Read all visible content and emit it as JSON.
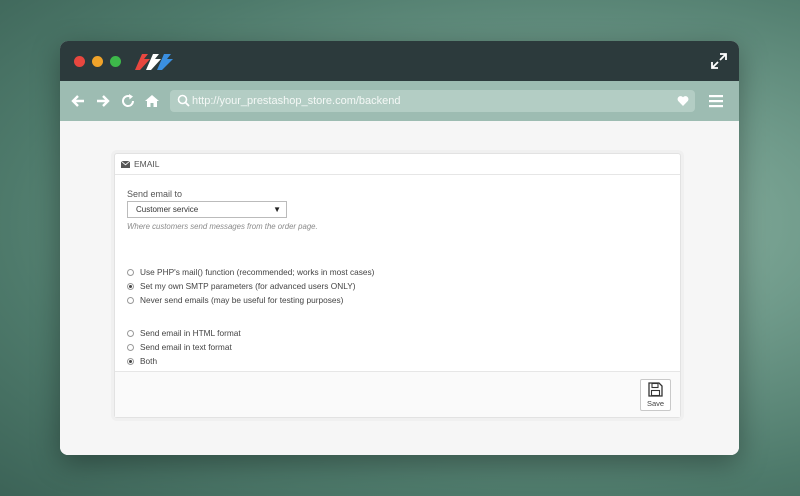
{
  "browser": {
    "url_placeholder": "http://your_prestashop_store.com/backend"
  },
  "panel": {
    "title": "EMAIL",
    "send_email_label": "Send email to",
    "send_email_value": "Customer service",
    "send_email_help": "Where customers send messages from the order page.",
    "method_options": [
      {
        "label": "Use PHP's mail() function (recommended; works in most cases)",
        "checked": false
      },
      {
        "label": "Set my own SMTP parameters (for advanced users ONLY)",
        "checked": true
      },
      {
        "label": "Never send emails (may be useful for testing purposes)",
        "checked": false
      }
    ],
    "format_options": [
      {
        "label": "Send email in HTML format",
        "checked": false
      },
      {
        "label": "Send email in text format",
        "checked": false
      },
      {
        "label": "Both",
        "checked": true
      }
    ],
    "save_label": "Save"
  },
  "colors": {
    "titlebar": "#2c3a3c",
    "navbar": "#9dbcb2",
    "close": "#e8473f",
    "minimize": "#f0a32a",
    "maximize": "#3db84a"
  },
  "icons": [
    "back-arrow-icon",
    "forward-arrow-icon",
    "refresh-icon",
    "home-icon",
    "search-icon",
    "heart-icon",
    "menu-icon",
    "expand-icon",
    "envelope-icon",
    "save-icon"
  ]
}
